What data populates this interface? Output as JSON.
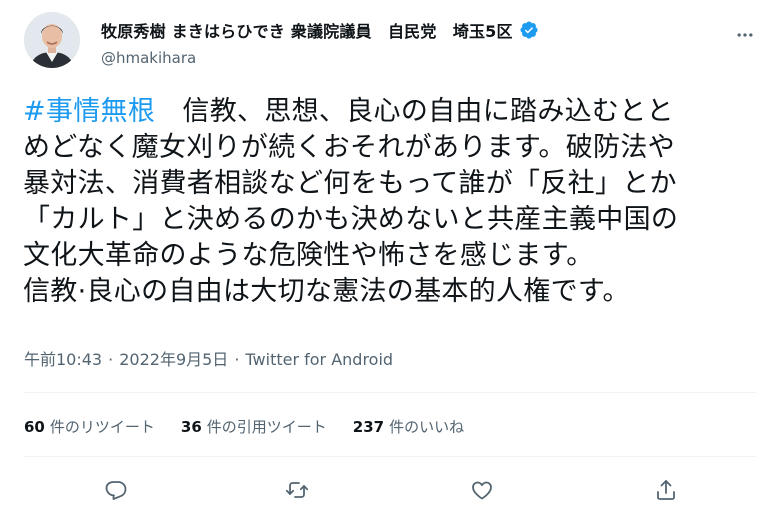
{
  "author": {
    "display_name": "牧原秀樹 まきはらひでき 衆議院議員　自民党　埼玉5区",
    "handle": "@hmakihara",
    "avatar": "profile-photo",
    "verified": true
  },
  "tweet": {
    "lines": [
      "#事情無根　信教、思想、良心の自由に踏み込むとと",
      "めどなく魔女刈りが続くおそれがあります。破防法や",
      "暴対法、消費者相談など何をもって誰が「反社」とか",
      "「カルト」と決めるのかも決めないと共産主義中国の",
      "文化大革命のような危険性や怖さを感じます。",
      "信教·良心の自由は大切な憲法の基本的人権です。"
    ],
    "hashtag": "#事情無根",
    "first_line_rest": "　信教、思想、良心の自由に踏み込むとと"
  },
  "meta": {
    "time": "午前10:43",
    "date": "2022年9月5日",
    "source": "Twitter for Android",
    "separator": "·"
  },
  "stats": [
    {
      "count": "60",
      "label": "件のリツイート"
    },
    {
      "count": "36",
      "label": "件の引用ツイート"
    },
    {
      "count": "237",
      "label": "件のいいね"
    }
  ],
  "actions": [
    {
      "icon": "reply-icon"
    },
    {
      "icon": "retweet-icon"
    },
    {
      "icon": "like-icon"
    },
    {
      "icon": "share-icon"
    }
  ],
  "colors": {
    "accent": "#1d9bf0",
    "text": "#0f1419",
    "muted": "#536471",
    "divider": "#eff3f4"
  }
}
